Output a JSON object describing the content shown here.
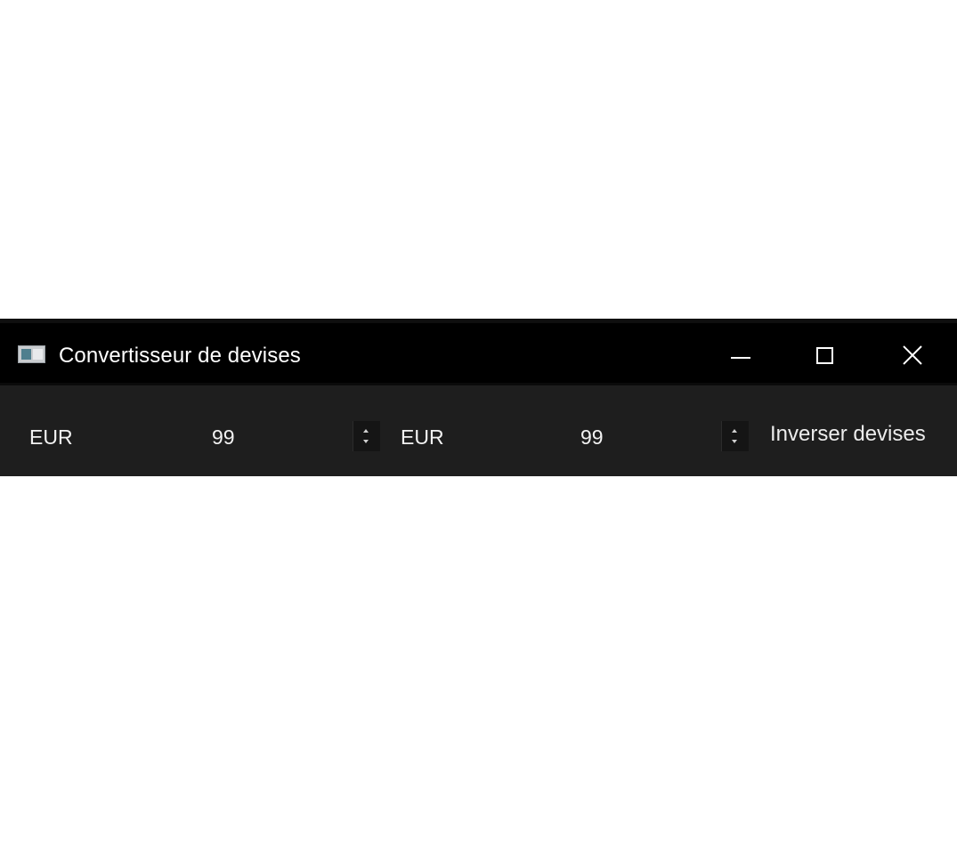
{
  "window": {
    "title": "Convertisseur de devises",
    "icon": "app-window-icon",
    "controls": {
      "minimize_icon": "minimize-icon",
      "maximize_icon": "maximize-icon",
      "close_icon": "close-icon"
    }
  },
  "converter": {
    "from": {
      "currency": "EUR",
      "amount": "99"
    },
    "to": {
      "currency": "EUR",
      "amount": "99"
    },
    "swap_label": "Inverser devises"
  },
  "colors": {
    "titlebar": "#000000",
    "body": "#1e1e1e",
    "text": "#ffffff"
  }
}
